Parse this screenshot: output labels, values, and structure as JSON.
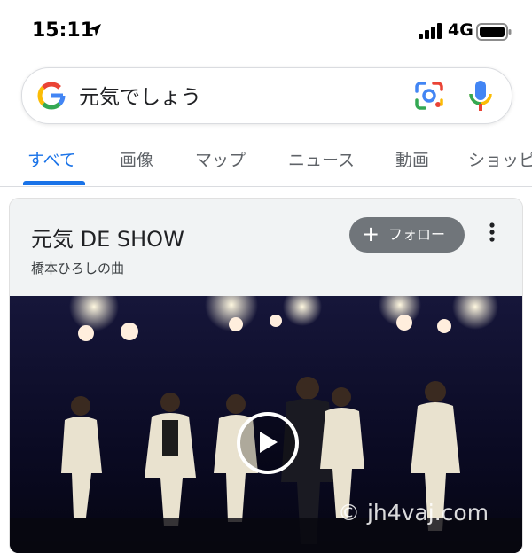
{
  "status_bar": {
    "time": "15:11",
    "network": "4G"
  },
  "search": {
    "query": "元気でしょう"
  },
  "tabs": [
    {
      "label": "すべて",
      "active": true
    },
    {
      "label": "画像"
    },
    {
      "label": "マップ"
    },
    {
      "label": "ニュース"
    },
    {
      "label": "動画"
    },
    {
      "label": "ショッピ"
    }
  ],
  "result_card": {
    "title": "元気 DE SHOW",
    "subtitle": "橋本ひろしの曲",
    "follow_label": "フォロー",
    "watermark": "© jh4vaj.com"
  },
  "colors": {
    "accent": "#1a73e8",
    "follow_bg": "#70757a",
    "card_bg": "#f1f3f4"
  },
  "icons": [
    "location-arrow-icon",
    "signal-icon",
    "battery-icon",
    "google-logo-icon",
    "lens-icon",
    "mic-icon",
    "plus-icon",
    "more-vert-icon",
    "play-icon"
  ]
}
